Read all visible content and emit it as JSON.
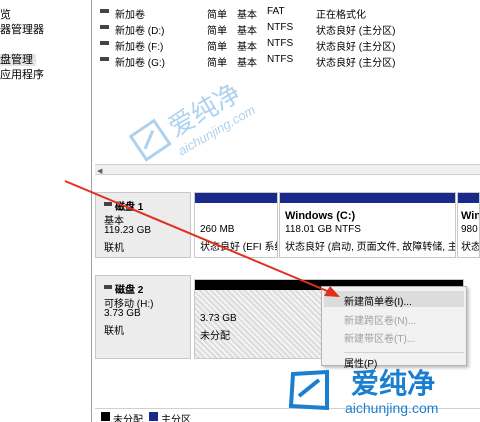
{
  "nav": {
    "items": [
      "览",
      "器管理器",
      "盘管理",
      "应用程序"
    ]
  },
  "volumes": {
    "rows": [
      {
        "name": "新加卷",
        "layout": "简单",
        "type": "基本",
        "fs": "FAT",
        "status": "正在格式化"
      },
      {
        "name": "新加卷 (D:)",
        "layout": "简单",
        "type": "基本",
        "fs": "NTFS",
        "status": "状态良好 (主分区)"
      },
      {
        "name": "新加卷 (F:)",
        "layout": "简单",
        "type": "基本",
        "fs": "NTFS",
        "status": "状态良好 (主分区)"
      },
      {
        "name": "新加卷 (G:)",
        "layout": "简单",
        "type": "基本",
        "fs": "NTFS",
        "status": "状态良好 (主分区)"
      }
    ]
  },
  "disk1": {
    "name": "磁盘 1",
    "type": "基本",
    "size": "119.23 GB",
    "state": "联机",
    "parts": [
      {
        "line1": "",
        "line2": "260 MB",
        "line3": "状态良好 (EFI 系统"
      },
      {
        "line1": "Windows  (C:)",
        "line2": "118.01 GB NTFS",
        "line3": "状态良好 (启动, 页面文件, 故障转储, 主"
      },
      {
        "line1": "Win",
        "line2": "980",
        "line3": "状态"
      }
    ]
  },
  "disk2": {
    "name": "磁盘 2",
    "type": "可移动 (H:)",
    "size": "3.73 GB",
    "state": "联机",
    "part": {
      "size": "3.73 GB",
      "label": "未分配"
    }
  },
  "context_menu": {
    "items": [
      {
        "label": "新建简单卷(I)...",
        "enabled": true
      },
      {
        "label": "新建跨区卷(N)...",
        "enabled": false
      },
      {
        "label": "新建带区卷(T)...",
        "enabled": false
      },
      {
        "label": "属性(P)",
        "enabled": true
      }
    ]
  },
  "legend": {
    "items": [
      {
        "label": "未分配",
        "color": "#000000"
      },
      {
        "label": "主分区",
        "color": "#1a2a8a"
      }
    ]
  },
  "watermark": {
    "center_text": "爱纯净",
    "center_sub": "aichunjing.com",
    "corner_text": "爱纯净",
    "corner_sub": "aichunjing.com"
  },
  "colors": {
    "primary_partition": "#1a2a8a",
    "unallocated": "#000000",
    "arrow": "#e03020",
    "watermark": "#1a7fd0"
  }
}
